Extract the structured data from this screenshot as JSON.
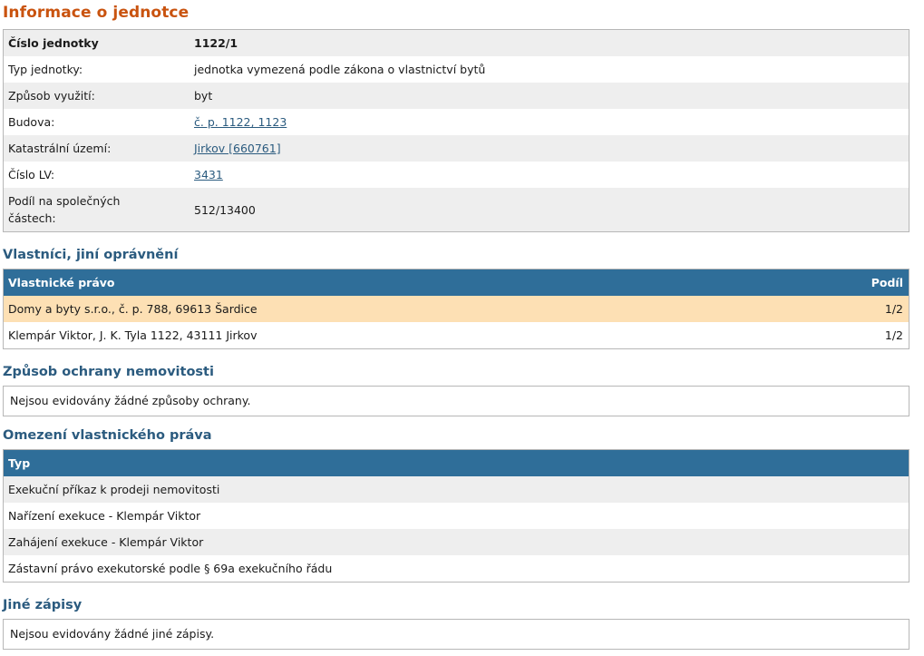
{
  "unit_info": {
    "title": "Informace o jednotce",
    "rows": [
      {
        "label": "Číslo jednotky",
        "value": "1122/1"
      },
      {
        "label": "Typ jednotky:",
        "value": "jednotka vymezená podle zákona o vlastnictví bytů"
      },
      {
        "label": "Způsob využití:",
        "value": "byt"
      },
      {
        "label": "Budova:",
        "value": "č. p. 1122, 1123"
      },
      {
        "label": "Katastrální území:",
        "value": "Jirkov [660761]"
      },
      {
        "label": "Číslo LV:",
        "value": "3431"
      },
      {
        "label": "Podíl na společných částech:",
        "value": "512/13400"
      }
    ]
  },
  "owners": {
    "title": "Vlastníci, jiní oprávnění",
    "col_right": "Vlastnické právo",
    "col_share": "Podíl",
    "rows": [
      {
        "name": "Domy a byty s.r.o., č. p. 788, 69613 Šardice",
        "share": "1/2"
      },
      {
        "name": "Klempár Viktor, J. K. Tyla 1122, 43111 Jirkov",
        "share": "1/2"
      }
    ]
  },
  "protection": {
    "title": "Způsob ochrany nemovitosti",
    "message": "Nejsou evidovány žádné způsoby ochrany."
  },
  "restrictions": {
    "title": "Omezení vlastnického práva",
    "col_type": "Typ",
    "rows": [
      "Exekuční příkaz k prodeji nemovitosti",
      "Nařízení exekuce - Klempár Viktor",
      "Zahájení exekuce - Klempár Viktor",
      "Zástavní právo exekutorské podle § 69a exekučního řádu"
    ]
  },
  "other": {
    "title": "Jiné zápisy",
    "message": "Nejsou evidovány žádné jiné zápisy."
  },
  "colors": {
    "heading_orange": "#c9530f",
    "heading_blue": "#2b5b7f",
    "table_header": "#2f6e99",
    "highlight_row": "#fde0b4",
    "stripe": "#eeeeee"
  }
}
